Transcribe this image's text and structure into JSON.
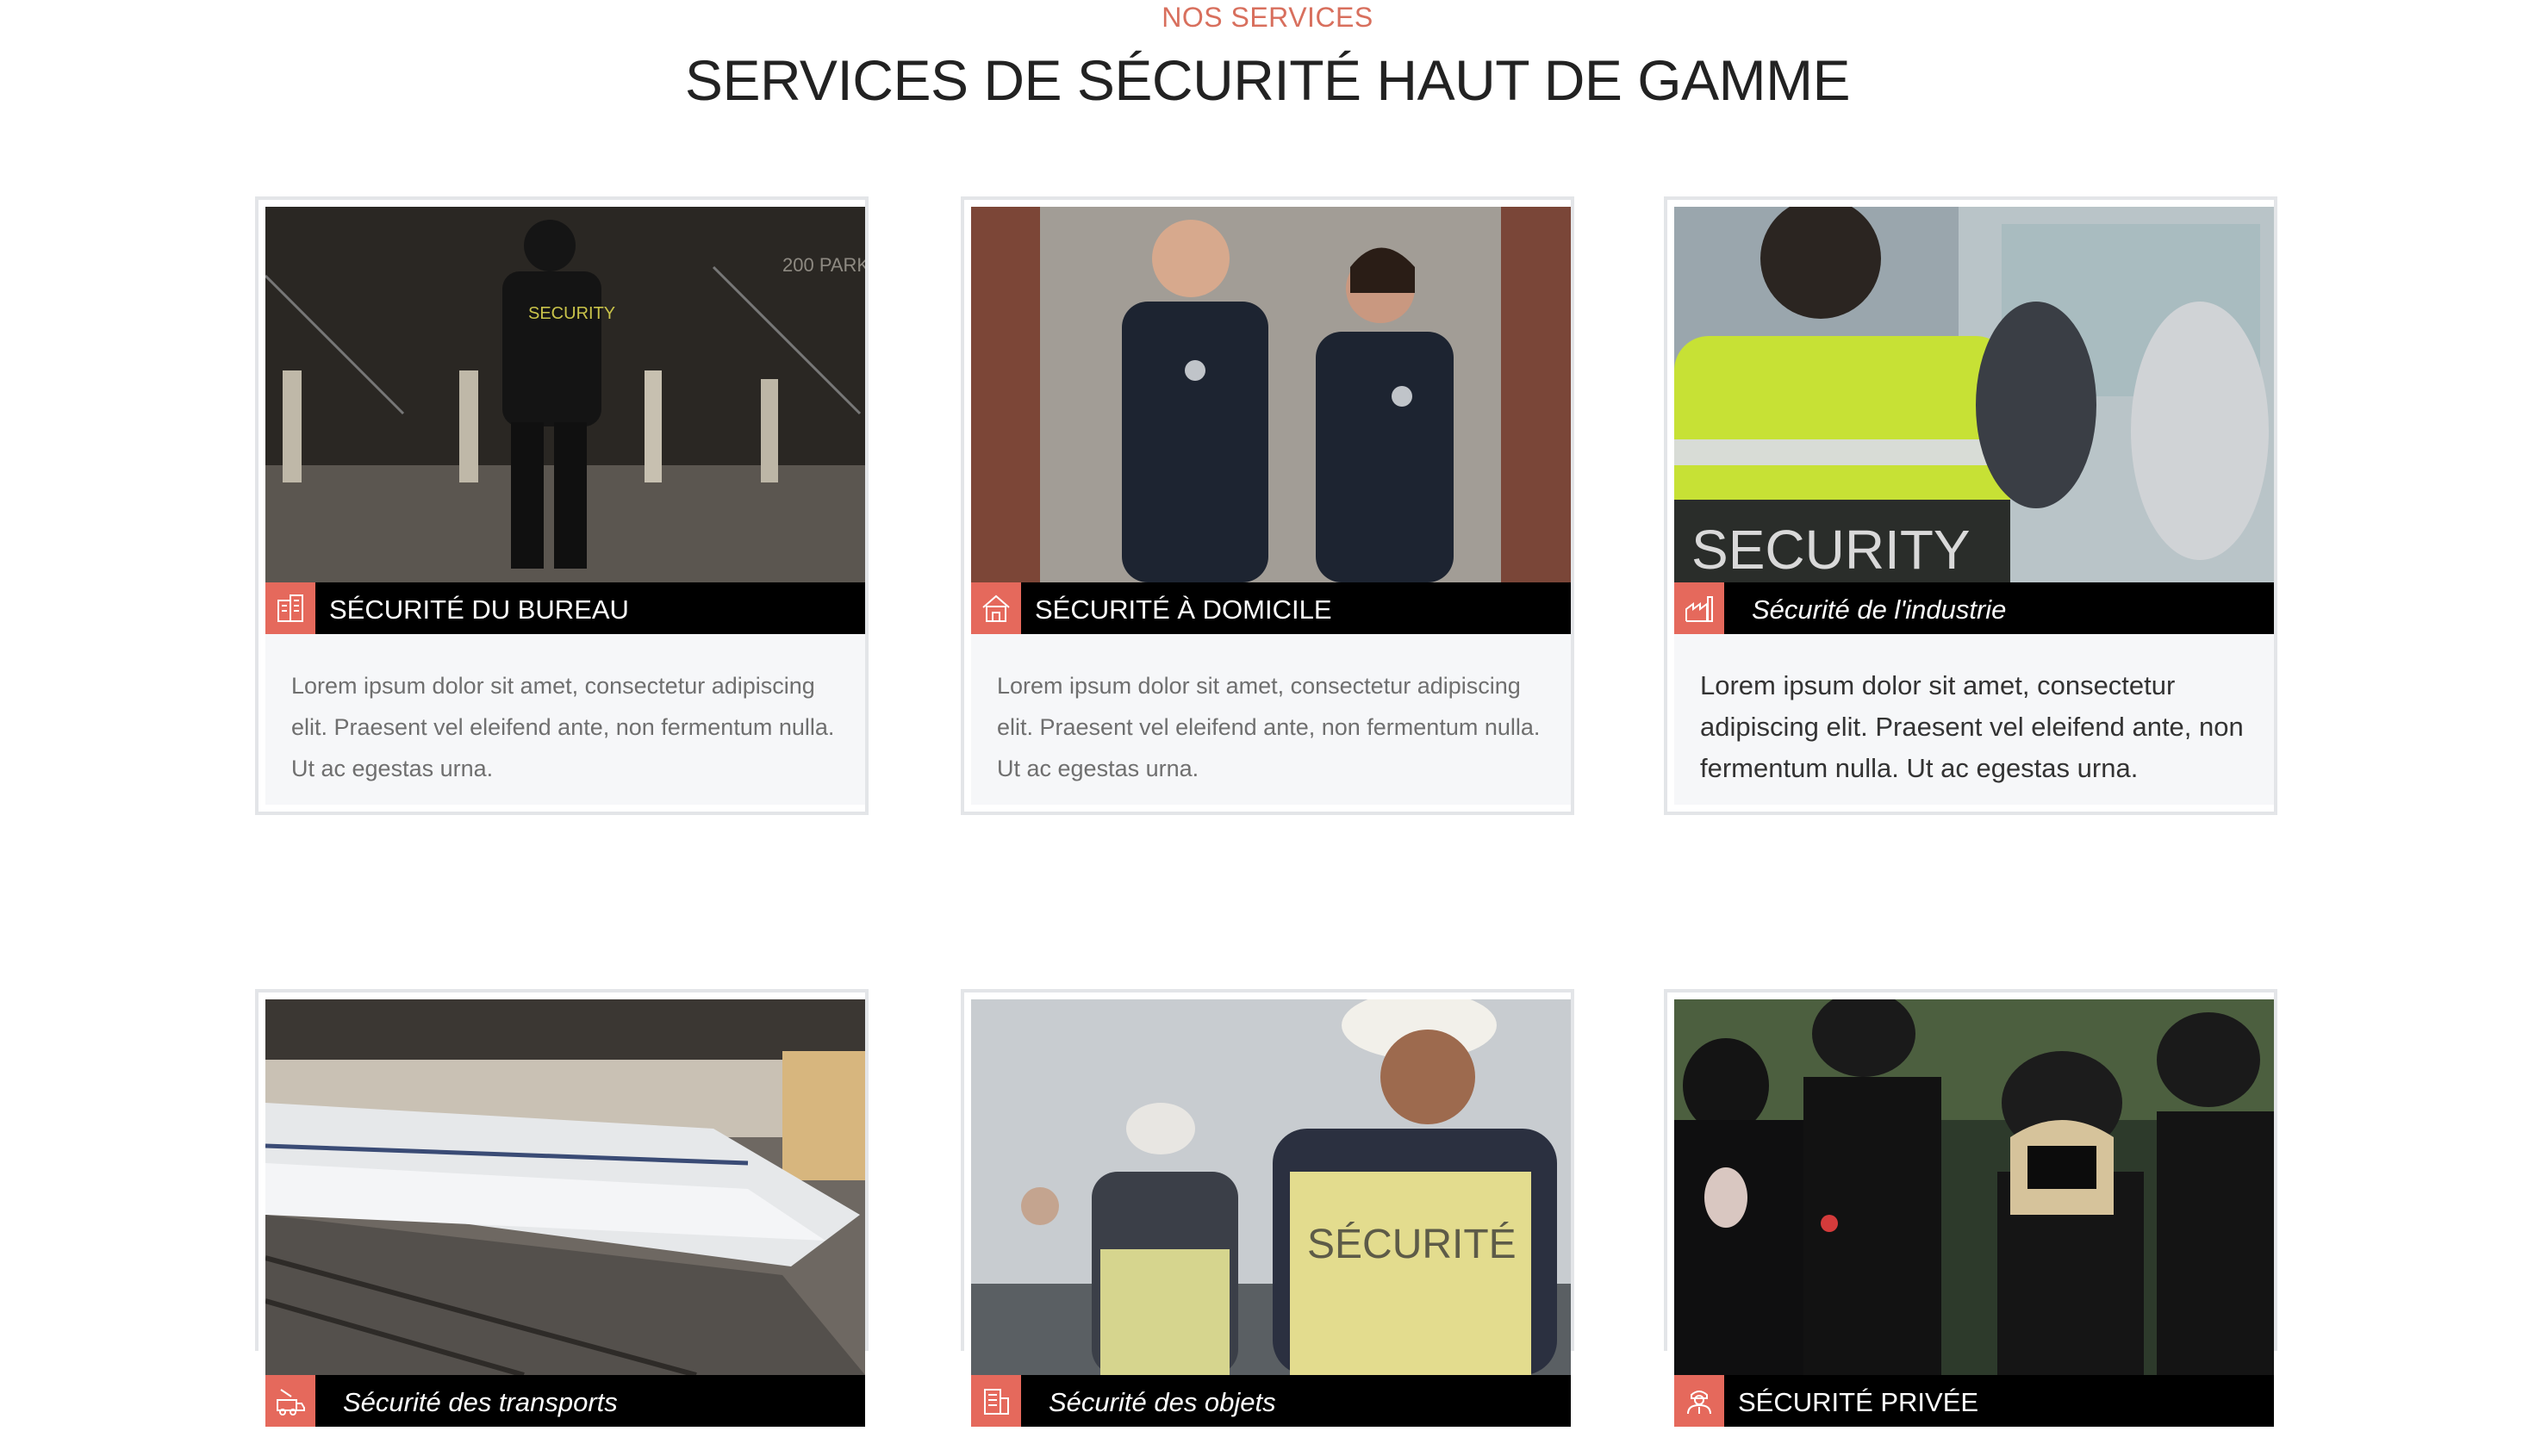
{
  "header": {
    "eyebrow": "NOS SERVICES",
    "title": "SERVICES DE SÉCURITÉ HAUT DE GAMME"
  },
  "colors": {
    "accent": "#e5695c",
    "eyebrow": "#d86f5d",
    "label_bg": "#000000"
  },
  "services": [
    {
      "label": "SÉCURITÉ DU BUREAU",
      "icon": "office-building-icon",
      "image": "security guard in dark office lobby",
      "description": "Lorem ipsum dolor sit amet, consectetur adipiscing elit. Praesent vel eleifend ante, non fermentum nulla. Ut ac egestas urna."
    },
    {
      "label": "SÉCURITÉ À DOMICILE",
      "icon": "home-icon",
      "image": "two police officers talking by a brick wall",
      "description": "Lorem ipsum dolor sit amet, consectetur adipiscing elit. Praesent vel eleifend ante, non fermentum nulla. Ut ac egestas urna."
    },
    {
      "label": "Sécurité de l'industrie",
      "icon": "factory-icon",
      "image": "security officer in high-visibility vest",
      "description": "Lorem ipsum dolor sit amet, consectetur adipiscing elit. Praesent vel eleifend ante, non fermentum nulla. Ut ac egestas urna."
    },
    {
      "label": "Sécurité des transports",
      "icon": "transport-icon",
      "image": "bullet train at a station platform"
    },
    {
      "label": "Sécurité des objets",
      "icon": "building-icon",
      "image": "security guards in hard hats and vests"
    },
    {
      "label": "SÉCURITÉ PRIVÉE",
      "icon": "guard-person-icon",
      "image": "armed security team in black gear"
    }
  ]
}
